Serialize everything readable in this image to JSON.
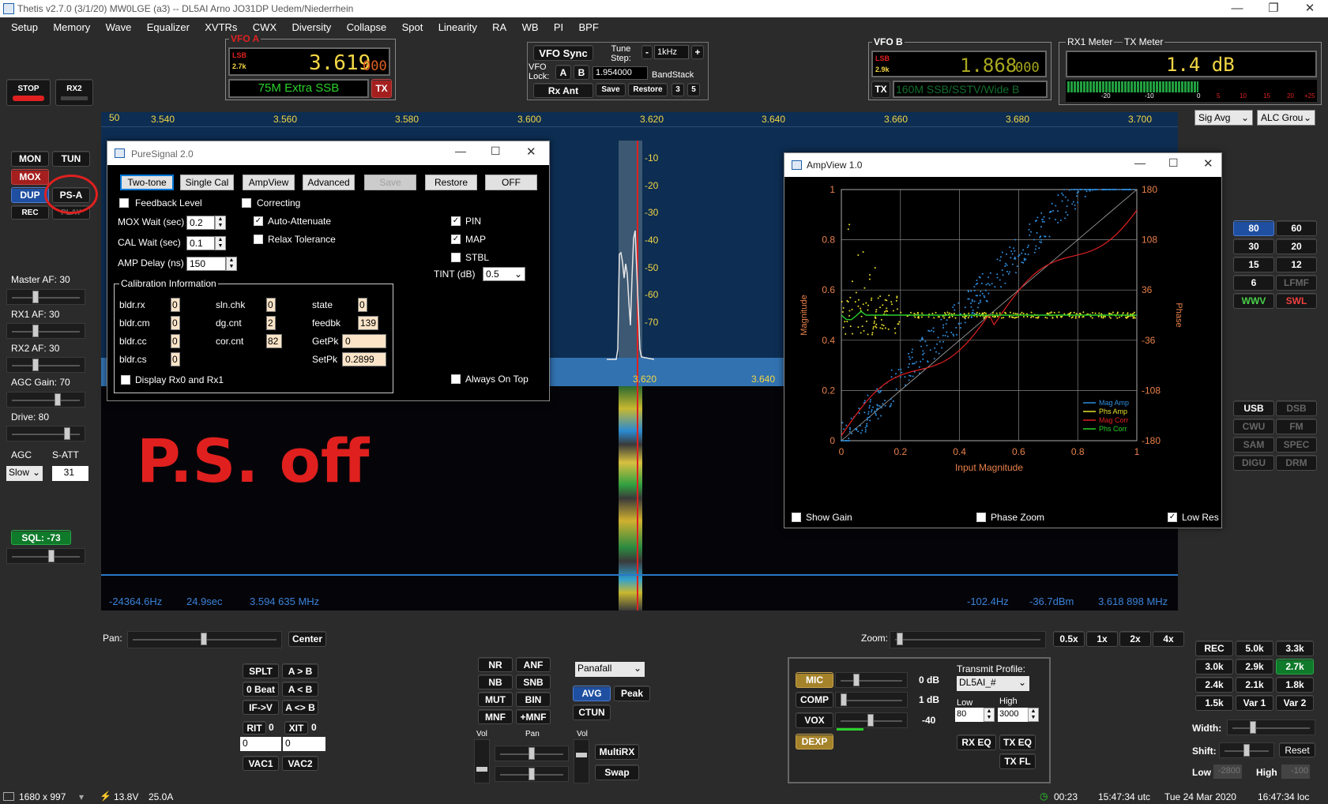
{
  "window": {
    "title": "Thetis v2.7.0 (3/1/20) MW0LGE (a3)  --  DL5AI  Arno  JO31DP  Uedem/Niederrhein"
  },
  "menu": [
    "Setup",
    "Memory",
    "Wave",
    "Equalizer",
    "XVTRs",
    "CWX",
    "Diversity",
    "Collapse",
    "Spot",
    "Linearity",
    "RA",
    "WB",
    "PI",
    "BPF"
  ],
  "top_buttons": {
    "stop": "STOP",
    "rx2": "RX2"
  },
  "vfo_a": {
    "label": "VFO A",
    "mode": "LSB",
    "filter": "2.7k",
    "freq_main": "3.619",
    "freq_sub": "000",
    "band": "75M Extra SSB",
    "tx": "TX"
  },
  "vfo_center": {
    "sync": "VFO Sync",
    "tune_step_label": "Tune Step:",
    "tune_step": "1kHz",
    "minus": "-",
    "plus": "+",
    "lock_label": "VFO Lock:",
    "a": "A",
    "b": "B",
    "freq_field": "1.954000",
    "bandstack": "BandStack",
    "rx_ant": "Rx Ant",
    "save": "Save",
    "restore": "Restore",
    "n3": "3",
    "n5": "5"
  },
  "vfo_b": {
    "label": "VFO B",
    "mode": "LSB",
    "filter": "2.9k",
    "freq_main": "1.868",
    "freq_sub": "000",
    "tx": "TX",
    "band": "160M SSB/SSTV/Wide B"
  },
  "meters": {
    "rx_label": "RX1 Meter",
    "tx_label": "TX Meter",
    "value": "1.4 dB",
    "scale": [
      "-20",
      "-10",
      "0",
      "5",
      "10",
      "15",
      "20",
      "+25"
    ],
    "sig_avg": "Sig Avg",
    "alc_group": "ALC Group"
  },
  "left_buttons": {
    "mon": "MON",
    "tun": "TUN",
    "mox": "MOX",
    "dup": "DUP",
    "psa": "PS-A",
    "rec": "REC",
    "play": "PLAY"
  },
  "left_sliders": [
    {
      "label": "Master AF:  30",
      "value": 30
    },
    {
      "label": "RX1 AF:  30",
      "value": 30
    },
    {
      "label": "RX2 AF:  30",
      "value": 30
    },
    {
      "label": "AGC Gain:  70",
      "value": 70
    },
    {
      "label": "Drive:  80",
      "value": 80
    }
  ],
  "agc": {
    "label": "AGC",
    "satt_label": "S-ATT",
    "mode": "Slow",
    "satt": "31"
  },
  "sql": {
    "label": "SQL: -73"
  },
  "overlay_text": "P.S. off",
  "panadapter": {
    "db_top": "50",
    "freq_ticks": [
      "3.540",
      "3.560",
      "3.580",
      "3.600",
      "3.620",
      "3.640",
      "3.660",
      "3.680",
      "3.700"
    ],
    "db_ticks": [
      "-10",
      "-20",
      "-30",
      "-40",
      "-50",
      "-60",
      "-70"
    ],
    "inner_ticks": [
      "3.620",
      "3.640"
    ]
  },
  "readouts": {
    "left_hz": "-24364.6Hz",
    "time": "24.9sec",
    "freq_left": "3.594 635 MHz",
    "right_hz": "-102.4Hz",
    "dbm": "-36.7dBm",
    "freq_right": "3.618 898 MHz"
  },
  "pan_zoom": {
    "pan_label": "Pan:",
    "center": "Center",
    "zoom_label": "Zoom:",
    "z05": "0.5x",
    "z1": "1x",
    "z2": "2x",
    "z4": "4x"
  },
  "puresignal": {
    "title": "PureSignal 2.0",
    "buttons": [
      "Two-tone",
      "Single Cal",
      "AmpView",
      "Advanced",
      "Save",
      "Restore",
      "OFF"
    ],
    "feedback_level": "Feedback Level",
    "correcting": "Correcting",
    "mox_wait_label": "MOX Wait (sec)",
    "mox_wait": "0.2",
    "auto_attenuate": "Auto-Attenuate",
    "cal_wait_label": "CAL Wait (sec)",
    "cal_wait": "0.1",
    "relax_tolerance": "Relax Tolerance",
    "amp_delay_label": "AMP Delay (ns)",
    "amp_delay": "150",
    "pin": "PIN",
    "map": "MAP",
    "stbl": "STBL",
    "tint_label": "TINT (dB)",
    "tint": "0.5",
    "cal_info": "Calibration Information",
    "fields": [
      {
        "label": "bldr.rx",
        "value": "0"
      },
      {
        "label": "bldr.cm",
        "value": "0"
      },
      {
        "label": "bldr.cc",
        "value": "0"
      },
      {
        "label": "bldr.cs",
        "value": "0"
      },
      {
        "label": "sln.chk",
        "value": "0"
      },
      {
        "label": "dg.cnt",
        "value": "2"
      },
      {
        "label": "cor.cnt",
        "value": "82"
      },
      {
        "label": "state",
        "value": "0"
      },
      {
        "label": "feedbk",
        "value": "139"
      },
      {
        "label": "GetPk",
        "value": "0"
      },
      {
        "label": "SetPk",
        "value": "0.2899"
      }
    ],
    "display_rx": "Display Rx0 and Rx1",
    "always_on_top": "Always On Top"
  },
  "ampview": {
    "title": "AmpView 1.0",
    "xlabel": "Input Magnitude",
    "ylabel_left": "Magnitude",
    "ylabel_right": "Phase",
    "x_ticks": [
      "0",
      "0.2",
      "0.4",
      "0.6",
      "0.8",
      "1"
    ],
    "y_ticks_left": [
      "1",
      "0.8",
      "0.6",
      "0.4",
      "0.2",
      "0"
    ],
    "y_ticks_right": [
      "180",
      "108",
      "36",
      "-36",
      "-108",
      "-180"
    ],
    "legend": [
      "Mag Amp",
      "Phs Amp",
      "Mag Corr",
      "Phs Corr"
    ],
    "legend_colors": [
      "#2e8fe0",
      "#e8e02a",
      "#e02020",
      "#2ad02a"
    ],
    "show_gain": "Show Gain",
    "phase_zoom": "Phase Zoom",
    "low_res": "Low Res"
  },
  "band_buttons": [
    "80",
    "60",
    "30",
    "20",
    "15",
    "12",
    "6",
    "LFMF",
    "WWV",
    "SWL"
  ],
  "mode_buttons": [
    "USB",
    "DSB",
    "CWU",
    "FM",
    "SAM",
    "SPEC",
    "DIGU",
    "DRM"
  ],
  "filter_buttons": [
    "REC",
    "5.0k",
    "3.3k",
    "3.0k",
    "2.9k",
    "2.7k",
    "2.4k",
    "2.1k",
    "1.8k",
    "1.5k",
    "Var 1",
    "Var 2"
  ],
  "filter_controls": {
    "width": "Width:",
    "shift": "Shift:",
    "reset": "Reset",
    "low": "Low",
    "low_val": "-2800",
    "high": "High",
    "high_val": "-100"
  },
  "vfo_ops": {
    "splt": "SPLT",
    "a_to_b": "A > B",
    "zero_beat": "0 Beat",
    "a_lt_b": "A < B",
    "if_v": "IF->V",
    "a_swap_b": "A <> B",
    "rit": "RIT",
    "rit_val": "0",
    "xit": "XIT",
    "xit_val": "0",
    "rit_in": "0",
    "xit_in": "0",
    "vac1": "VAC1",
    "vac2": "VAC2"
  },
  "dsp": {
    "nr": "NR",
    "anf": "ANF",
    "nb": "NB",
    "snb": "SNB",
    "mut": "MUT",
    "bin": "BIN",
    "mnf": "MNF",
    "pmnf": "+MNF",
    "display_mode": "Panafall",
    "avg": "AVG",
    "peak": "Peak",
    "ctun": "CTUN",
    "vol1": "Vol",
    "pan": "Pan",
    "vol2": "Vol",
    "multirx": "MultiRX",
    "swap": "Swap"
  },
  "tx_panel": {
    "mic": "MIC",
    "mic_val": "0 dB",
    "comp": "COMP",
    "comp_val": "1 dB",
    "vox": "VOX",
    "vox_val": "-40",
    "dexp": "DEXP",
    "profile_label": "Transmit Profile:",
    "profile": "DL5AI_#",
    "low_label": "Low",
    "high_label": "High",
    "low": "80",
    "high": "3000",
    "rx_eq": "RX EQ",
    "tx_eq": "TX EQ",
    "tx_fl": "TX FL"
  },
  "status": {
    "res": "1680 x 997",
    "volts": "13.8V",
    "amps": "25.0A",
    "timer": "00:23",
    "utc": "15:47:34 utc",
    "date": "Tue 24 Mar 2020",
    "loc": "16:47:34 loc"
  }
}
